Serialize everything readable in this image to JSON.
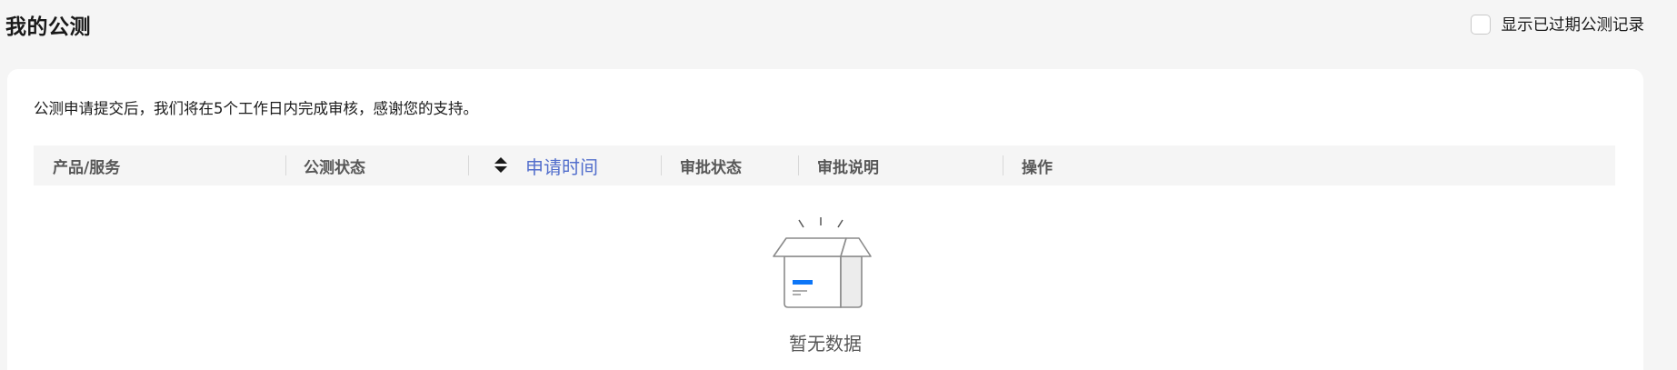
{
  "header": {
    "title": "我的公测",
    "show_expired_label": "显示已过期公测记录"
  },
  "notice": "公测申请提交后，我们将在5个工作日内完成审核，感谢您的支持。",
  "table": {
    "columns": [
      {
        "label": "产品/服务"
      },
      {
        "label": "公测状态"
      },
      {
        "label": "申请时间",
        "sortable": true
      },
      {
        "label": "审批状态"
      },
      {
        "label": "审批说明"
      },
      {
        "label": "操作"
      }
    ],
    "rows": []
  },
  "empty_state": {
    "text": "暂无数据",
    "icon": "empty-box-icon"
  },
  "colors": {
    "accent": "#526ecc",
    "brand_blue": "#0d76f7",
    "header_bg": "#f5f5f5"
  }
}
